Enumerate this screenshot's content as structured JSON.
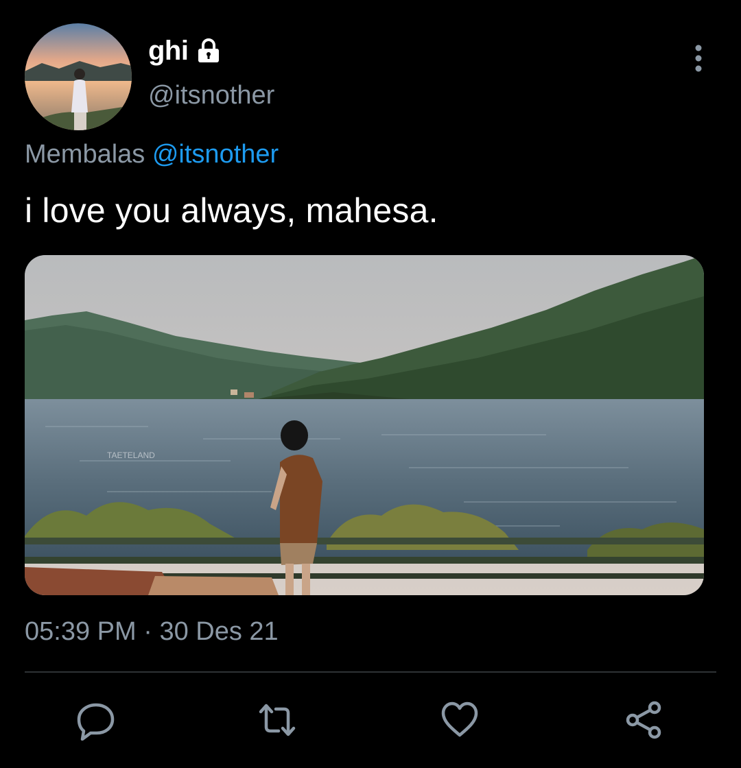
{
  "tweet": {
    "author": {
      "display_name": "ghi",
      "handle": "@itsnother",
      "protected_icon": "lock-icon"
    },
    "reply_prefix": "Membalas",
    "reply_to": "@itsnother",
    "text": "i love you always, mahesa.",
    "media_watermark": "TAETELAND",
    "time": "05:39 PM",
    "separator": " · ",
    "date": "30 Des 21"
  },
  "actions": [
    {
      "icon": "reply-icon"
    },
    {
      "icon": "retweet-icon"
    },
    {
      "icon": "like-icon"
    },
    {
      "icon": "share-icon"
    }
  ],
  "colors": {
    "background": "#000000",
    "primary_text": "#ffffff",
    "secondary_text": "#8b98a5",
    "link": "#1d9bf0",
    "divider": "#2f3336"
  }
}
